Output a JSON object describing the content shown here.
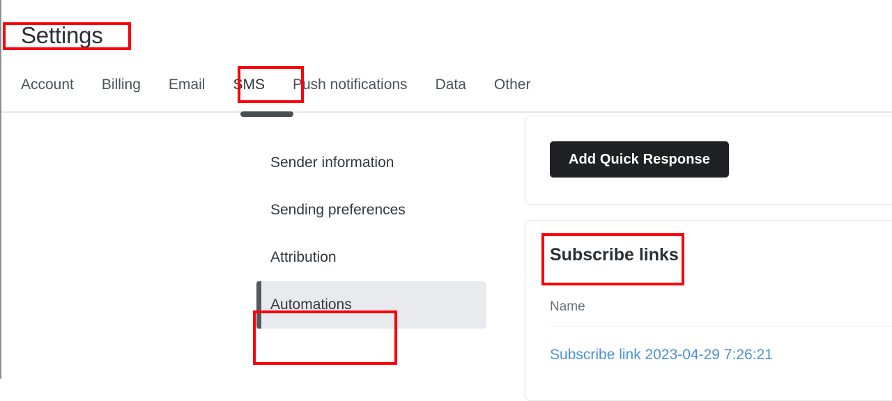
{
  "header": {
    "title": "Settings"
  },
  "tabs": [
    {
      "label": "Account",
      "active": false
    },
    {
      "label": "Billing",
      "active": false
    },
    {
      "label": "Email",
      "active": false
    },
    {
      "label": "SMS",
      "active": true
    },
    {
      "label": "Push notifications",
      "active": false
    },
    {
      "label": "Data",
      "active": false
    },
    {
      "label": "Other",
      "active": false
    }
  ],
  "settings_nav": {
    "items": [
      {
        "label": "Sender information",
        "active": false
      },
      {
        "label": "Sending preferences",
        "active": false
      },
      {
        "label": "Attribution",
        "active": false
      },
      {
        "label": "Automations",
        "active": true
      }
    ]
  },
  "quick_response_card": {
    "add_button_label": "Add Quick Response"
  },
  "subscribe_links_card": {
    "title": "Subscribe links",
    "table": {
      "columns": [
        "Name"
      ],
      "rows": [
        {
          "name": "Subscribe link 2023-04-29 7:26:21"
        }
      ]
    }
  },
  "annotations": {
    "color": "#fb0007",
    "boxes": [
      {
        "target": "page-title"
      },
      {
        "target": "tab-sms"
      },
      {
        "target": "sidebar-item-automations"
      },
      {
        "target": "subscribe-links-title"
      }
    ]
  },
  "theme": {
    "accent_dark": "#1f2124",
    "link_blue": "#4a91d6",
    "active_nav_bg": "#e8eaed",
    "divider": "#e3e5e8"
  }
}
